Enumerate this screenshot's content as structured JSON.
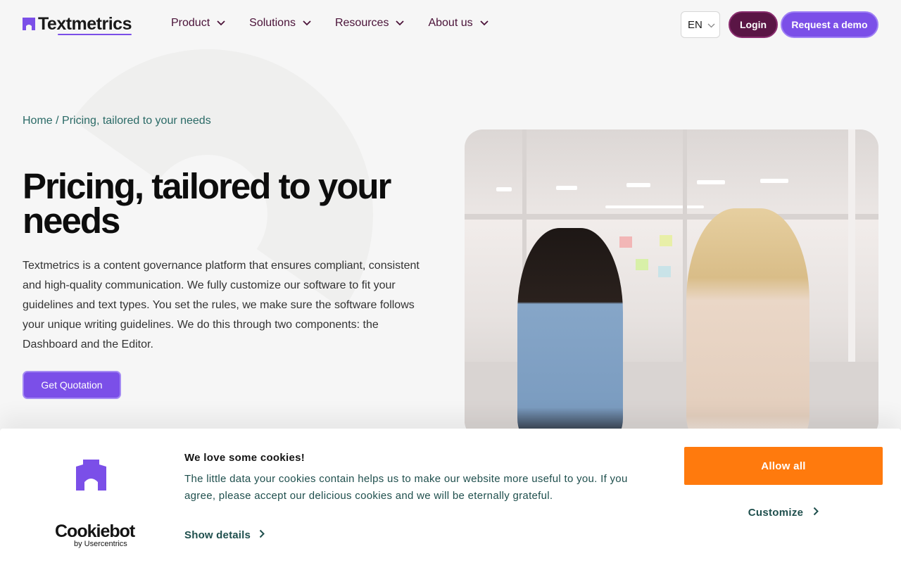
{
  "header": {
    "brand": "Textmetrics",
    "nav": [
      {
        "label": "Product"
      },
      {
        "label": "Solutions"
      },
      {
        "label": "Resources"
      },
      {
        "label": "About us"
      }
    ],
    "language": "EN",
    "login_label": "Login",
    "demo_label": "Request a demo"
  },
  "hero": {
    "breadcrumb_home": "Home",
    "breadcrumb_sep": " / ",
    "breadcrumb_current": "Pricing, tailored to your needs",
    "title": "Pricing, tailored to your needs",
    "description": "Textmetrics is a content governance platform that ensures compliant, consistent and high-quality communication. We fully customize our software to fit your guidelines and text types. You set the rules, we make sure the software follows your unique writing guidelines. We do this through two components: the Dashboard and the Editor.",
    "cta_label": "Get Quotation"
  },
  "cookie_banner": {
    "title": "We love some cookies!",
    "text": "The little data your cookies contain helps us to make our website more useful to you. If you agree, please accept our delicious cookies and we will be eternally grateful.",
    "show_details_label": "Show details",
    "allow_all_label": "Allow all",
    "customize_label": "Customize",
    "provider_name": "Cookiebot",
    "provider_sub": "by Usercentrics"
  },
  "colors": {
    "brand_purple": "#7b4fe8",
    "login_plum": "#5a1545",
    "cookie_orange": "#ff7a0d",
    "teal_text": "#1f4f4d"
  },
  "icons": [
    "logo-mark-icon",
    "chevron-down-icon",
    "chevron-right-icon",
    "cookie-brand-icon"
  ]
}
